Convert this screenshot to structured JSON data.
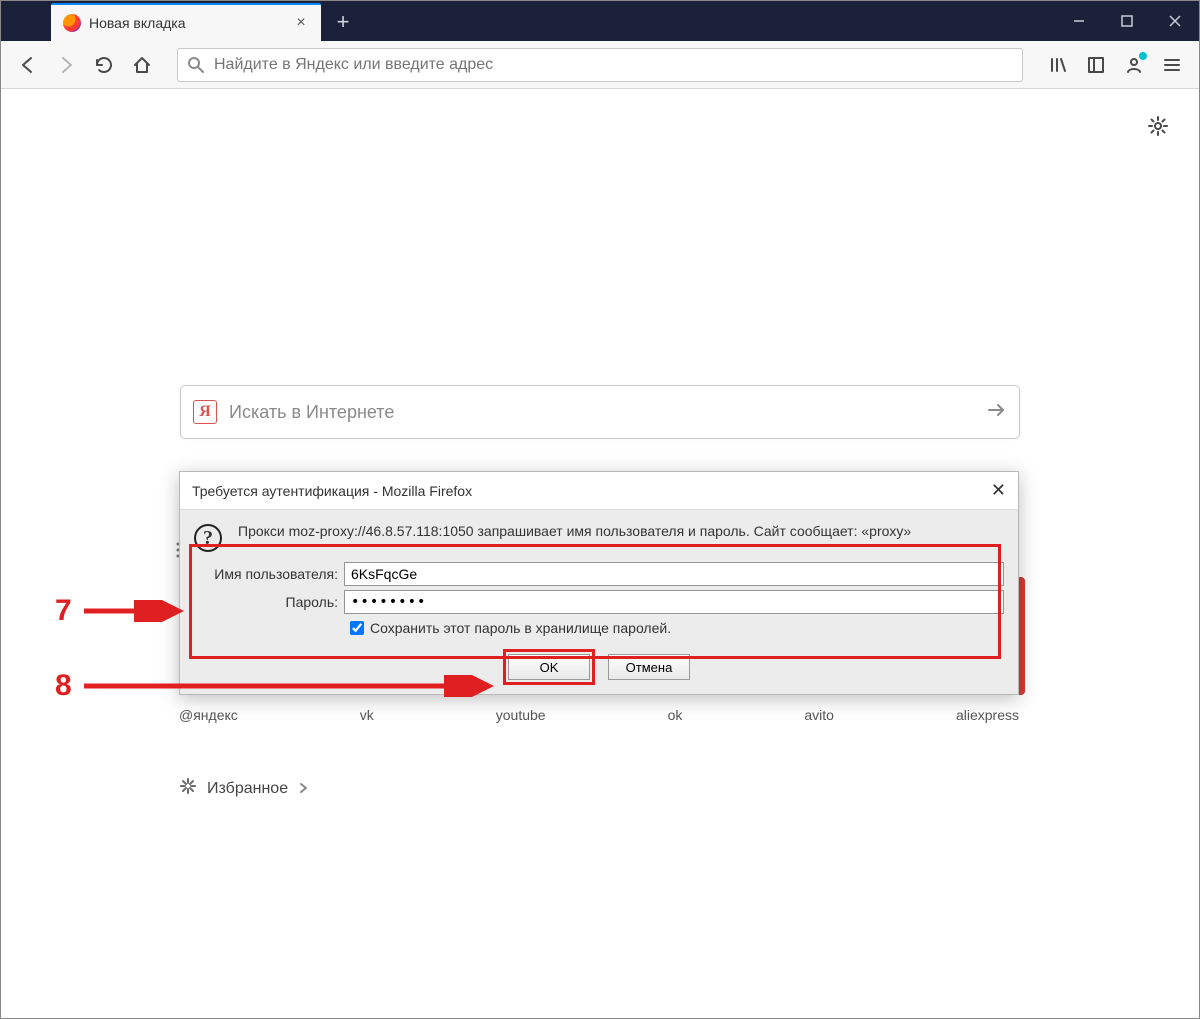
{
  "tab": {
    "title": "Новая вкладка",
    "close_label": "×"
  },
  "window_controls": {
    "minimize": "—",
    "maximize": "□",
    "close": "×"
  },
  "navbar": {
    "url_placeholder": "Найдите в Яндекс или введите адрес"
  },
  "newtab_page": {
    "yandex_letter": "Я",
    "center_search_placeholder": "Искать в Интернете",
    "favorites_label": "Избранное",
    "topsites": [
      "@яндекс",
      "vk",
      "youtube",
      "ok",
      "avito",
      "aliexpress"
    ]
  },
  "dialog": {
    "title": "Требуется аутентификация - Mozilla Firefox",
    "message": "Прокси moz-proxy://46.8.57.118:1050 запрашивает имя пользователя и пароль. Сайт сообщает: «proxy»",
    "username_label": "Имя пользователя:",
    "password_label": "Пароль:",
    "username_value": "6KsFqcGe",
    "password_value": "••••••••",
    "save_checkbox_label": "Сохранить этот пароль в хранилище паролей.",
    "ok_label": "OK",
    "cancel_label": "Отмена"
  },
  "annotations": {
    "step7": "7",
    "step8": "8"
  }
}
